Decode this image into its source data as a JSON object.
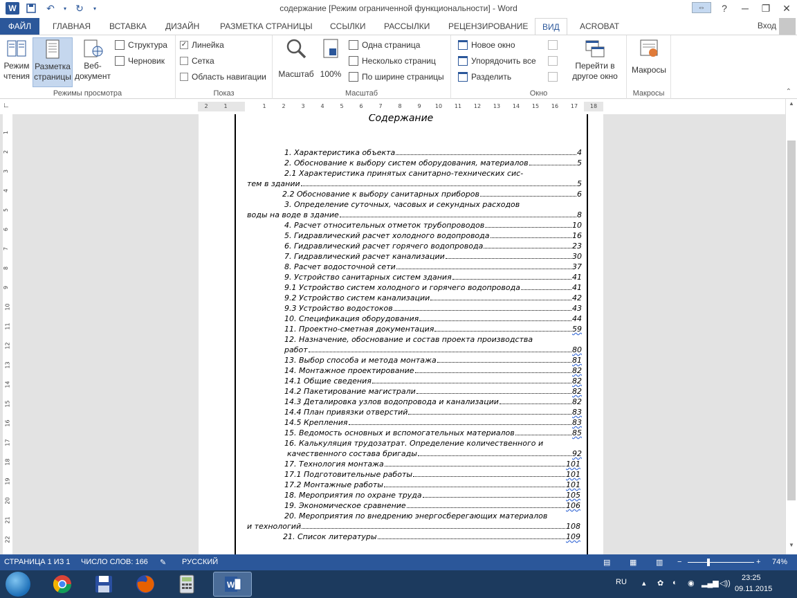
{
  "window": {
    "title": "содержание [Режим ограниченной функциональности] - Word"
  },
  "qat": {
    "word_logo": "W",
    "icons": [
      "save-icon",
      "undo-icon",
      "redo-icon",
      "customize-icon"
    ]
  },
  "tabs": [
    {
      "label": "ФАЙЛ"
    },
    {
      "label": "ГЛАВНАЯ"
    },
    {
      "label": "ВСТАВКА"
    },
    {
      "label": "ДИЗАЙН"
    },
    {
      "label": "РАЗМЕТКА СТРАНИЦЫ"
    },
    {
      "label": "ССЫЛКИ"
    },
    {
      "label": "РАССЫЛКИ"
    },
    {
      "label": "РЕЦЕНЗИРОВАНИЕ"
    },
    {
      "label": "ВИД"
    },
    {
      "label": "ACROBAT"
    }
  ],
  "active_tab": "ВИД",
  "signin": "Вход",
  "ribbon": {
    "views": {
      "label": "Режимы просмотра",
      "read_mode": [
        "Режим",
        "чтения"
      ],
      "print_layout": [
        "Разметка",
        "страницы"
      ],
      "web_layout": [
        "Веб-",
        "документ"
      ],
      "outline": "Структура",
      "draft": "Черновик"
    },
    "show": {
      "label": "Показ",
      "ruler": "Линейка",
      "gridlines": "Сетка",
      "navigation": "Область навигации"
    },
    "zoom": {
      "label": "Масштаб",
      "zoom": "Масштаб",
      "hundred": "100%",
      "one_page": "Одна страница",
      "multiple_pages": "Несколько страниц",
      "page_width": "По ширине страницы"
    },
    "window": {
      "label": "Окно",
      "new_window": "Новое окно",
      "arrange_all": "Упорядочить все",
      "split": "Разделить",
      "switch_windows": [
        "Перейти в",
        "другое окно"
      ]
    },
    "macros": {
      "label": "Макросы",
      "macros": "Макросы"
    }
  },
  "ruler_ticks": [
    "2",
    "1",
    "1",
    "2",
    "3",
    "4",
    "5",
    "6",
    "7",
    "8",
    "9",
    "10",
    "11",
    "12",
    "13",
    "14",
    "15",
    "16",
    "17",
    "18"
  ],
  "vruler_ticks": [
    "1",
    "2",
    "3",
    "4",
    "5",
    "6",
    "7",
    "8",
    "9",
    "10",
    "11",
    "12",
    "13",
    "14",
    "15",
    "16",
    "17",
    "18",
    "19",
    "20",
    "21",
    "22"
  ],
  "document": {
    "heading": "Содержание",
    "toc": [
      {
        "text": "1.  Характеристика объекта",
        "page": "4"
      },
      {
        "text": "2.  Обоснование к выбору систем оборудования, материалов",
        "page": "5"
      },
      {
        "text": "2.1  Характеристика принятых санитарно-технических сис-",
        "page": ""
      },
      {
        "text": "тем в здании",
        "page": "5"
      },
      {
        "text": "2.2  Обоснование к выбору санитарных приборов",
        "page": "6"
      },
      {
        "text": "3.  Определение суточных, часовых и секундных расходов",
        "page": ""
      },
      {
        "text": "воды на воде в здание",
        "page": "8"
      },
      {
        "text": "4.  Расчет относительных отметок трубопроводов",
        "page": "10"
      },
      {
        "text": "5.  Гидравлический расчет холодного водопровода",
        "page": "16"
      },
      {
        "text": "6.  Гидравлический расчет горячего водопровода",
        "page": "23"
      },
      {
        "text": "7.  Гидравлический расчет канализации",
        "page": "30"
      },
      {
        "text": "8.  Расчет водосточной сети",
        "page": "37"
      },
      {
        "text": "9.  Устройство санитарных систем здания",
        "page": "41"
      },
      {
        "text": "9.1  Устройство систем холодного и горячего водопровода",
        "page": "41"
      },
      {
        "text": "9.2  Устройство систем канализации",
        "page": "42"
      },
      {
        "text": "9.3  Устройство водостоков",
        "page": "43"
      },
      {
        "text": "10.  Спецификация оборудования",
        "page": "44"
      },
      {
        "text": "11.  Проектно-сметная документация",
        "page": "59"
      },
      {
        "text": "12.  Назначение, обоснование и состав проекта производства",
        "page": ""
      },
      {
        "text": "работ",
        "page": "80"
      },
      {
        "text": "13.  Выбор способа и метода монтажа",
        "page": "81"
      },
      {
        "text": "14.  Монтажное проектирование",
        "page": "82"
      },
      {
        "text": "14.1  Общие сведения",
        "page": "82"
      },
      {
        "text": "14.2  Пакетирование магистрали",
        "page": "82"
      },
      {
        "text": "14.3  Деталировка узлов водопровода и канализации",
        "page": "82"
      },
      {
        "text": "14.4  План привязки отверстий",
        "page": "83"
      },
      {
        "text": "14.5  Крепления",
        "page": "83"
      },
      {
        "text": "15.  Ведомость основных и вспомогательных материалов",
        "page": "85"
      },
      {
        "text": "16.  Калькуляция трудозатрат. Определение количественного и",
        "page": ""
      },
      {
        "text": "качественного состава бригады",
        "page": "92"
      },
      {
        "text": "17.  Технология монтажа",
        "page": "101"
      },
      {
        "text": "17.1  Подготовительные работы",
        "page": "101"
      },
      {
        "text": "17.2  Монтажные работы",
        "page": "101"
      },
      {
        "text": "18.  Мероприятия по охране труда",
        "page": "105"
      },
      {
        "text": "19.  Экономическое сравнение",
        "page": "106"
      },
      {
        "text": "20.  Мероприятия по внедрению энергосберегающих материалов",
        "page": ""
      },
      {
        "text": "и технологий",
        "page": "108"
      },
      {
        "text": "21.  Список литературы",
        "page": "109"
      }
    ]
  },
  "status": {
    "page": "СТРАНИЦА 1 ИЗ 1",
    "words": "ЧИСЛО СЛОВ: 166",
    "language": "РУССКИЙ",
    "zoom": "74%"
  },
  "taskbar": {
    "apps": [
      "chrome-icon",
      "save-app-icon",
      "firefox-icon",
      "calculator-icon",
      "word-icon"
    ],
    "lang": "RU",
    "time": "23:25",
    "date": "09.11.2015"
  }
}
